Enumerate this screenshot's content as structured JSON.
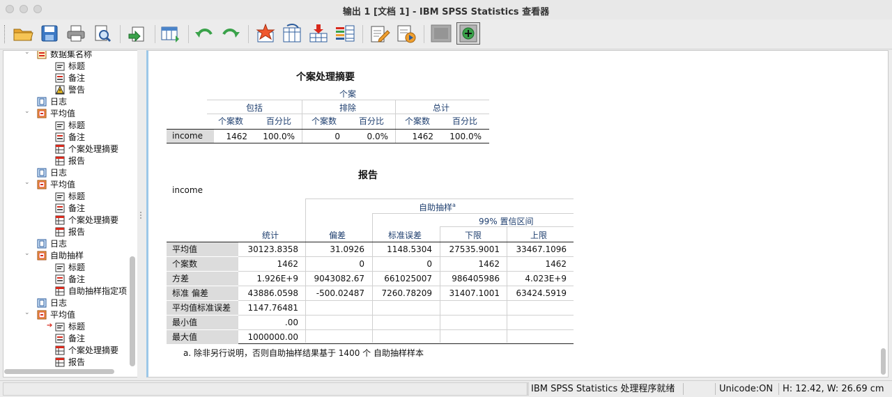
{
  "window": {
    "title": "输出 1 [文档 1] - IBM SPSS Statistics 查看器"
  },
  "toolbar": {
    "buttons": [
      {
        "icon": "open-folder-icon"
      },
      {
        "icon": "save-icon"
      },
      {
        "icon": "print-icon"
      },
      {
        "icon": "print-preview-icon"
      },
      {
        "icon": "export-icon"
      },
      {
        "icon": "goto-data-icon"
      },
      {
        "icon": "undo-icon"
      },
      {
        "icon": "redo-icon"
      },
      {
        "icon": "goto-case-icon"
      },
      {
        "icon": "goto-variable-icon"
      },
      {
        "icon": "insert-cases-icon"
      },
      {
        "icon": "variables-icon"
      },
      {
        "icon": "edit-output-icon"
      },
      {
        "icon": "run-script-icon"
      },
      {
        "icon": "hide-icon"
      },
      {
        "icon": "show-icon"
      }
    ]
  },
  "tree": {
    "items": [
      {
        "label": "数据集名称",
        "level": 2,
        "icon": "dataset-icon"
      },
      {
        "label": "标题",
        "level": 3,
        "icon": "title-icon"
      },
      {
        "label": "备注",
        "level": 3,
        "icon": "notes-icon"
      },
      {
        "label": "警告",
        "level": 3,
        "icon": "warning-icon"
      },
      {
        "label": "日志",
        "level": 2,
        "icon": "log-icon"
      },
      {
        "label": "平均值",
        "level": 1,
        "icon": "procedure-icon"
      },
      {
        "label": "标题",
        "level": 3,
        "icon": "title-icon"
      },
      {
        "label": "备注",
        "level": 3,
        "icon": "notes-icon"
      },
      {
        "label": "个案处理摘要",
        "level": 3,
        "icon": "table-icon"
      },
      {
        "label": "报告",
        "level": 3,
        "icon": "table-icon"
      },
      {
        "label": "日志",
        "level": 2,
        "icon": "log-icon"
      },
      {
        "label": "平均值",
        "level": 1,
        "icon": "procedure-icon"
      },
      {
        "label": "标题",
        "level": 3,
        "icon": "title-icon"
      },
      {
        "label": "备注",
        "level": 3,
        "icon": "notes-icon"
      },
      {
        "label": "个案处理摘要",
        "level": 3,
        "icon": "table-icon"
      },
      {
        "label": "报告",
        "level": 3,
        "icon": "table-icon"
      },
      {
        "label": "日志",
        "level": 2,
        "icon": "log-icon"
      },
      {
        "label": "自助抽样",
        "level": 1,
        "icon": "procedure-icon"
      },
      {
        "label": "标题",
        "level": 3,
        "icon": "title-icon"
      },
      {
        "label": "备注",
        "level": 3,
        "icon": "notes-icon"
      },
      {
        "label": "自助抽样指定项",
        "level": 3,
        "icon": "table-icon"
      },
      {
        "label": "日志",
        "level": 2,
        "icon": "log-icon"
      },
      {
        "label": "平均值",
        "level": 1,
        "icon": "procedure-icon"
      },
      {
        "label": "标题",
        "level": 3,
        "icon": "title-icon",
        "current": true
      },
      {
        "label": "备注",
        "level": 3,
        "icon": "notes-icon"
      },
      {
        "label": "个案处理摘要",
        "level": 3,
        "icon": "table-icon"
      },
      {
        "label": "报告",
        "level": 3,
        "icon": "table-icon"
      }
    ]
  },
  "summary": {
    "title": "个案处理摘要",
    "cases_header": "个案",
    "groups": [
      "包括",
      "排除",
      "总计"
    ],
    "subheaders": [
      "个案数",
      "百分比",
      "个案数",
      "百分比",
      "个案数",
      "百分比"
    ],
    "row_label": "income",
    "values": [
      "1462",
      "100.0%",
      "0",
      "0.0%",
      "1462",
      "100.0%"
    ]
  },
  "report": {
    "title": "报告",
    "variable": "income",
    "bootstrap_header": "自助抽样",
    "footnote_marker": "a",
    "ci_header": "99% 置信区间",
    "col_headers": [
      "统计",
      "偏差",
      "标准误差",
      "下限",
      "上限"
    ],
    "rows": [
      {
        "label": "平均值",
        "values": [
          "30123.8358",
          "31.0926",
          "1148.5304",
          "27535.9001",
          "33467.1096"
        ]
      },
      {
        "label": "个案数",
        "values": [
          "1462",
          "0",
          "0",
          "1462",
          "1462"
        ]
      },
      {
        "label": "方差",
        "values": [
          "1.926E+9",
          "9043082.67",
          "661025007",
          "986405986",
          "4.023E+9"
        ]
      },
      {
        "label": "标准 偏差",
        "values": [
          "43886.0598",
          "-500.02487",
          "7260.78209",
          "31407.1001",
          "63424.5919"
        ]
      },
      {
        "label": "平均值标准误差",
        "values": [
          "1147.76481",
          "",
          "",
          "",
          ""
        ]
      },
      {
        "label": "最小值",
        "values": [
          ".00",
          "",
          "",
          "",
          ""
        ]
      },
      {
        "label": "最大值",
        "values": [
          "1000000.00",
          "",
          "",
          "",
          ""
        ]
      }
    ],
    "footnote": "a. 除非另行说明，否则自助抽样结果基于 1400 个 自助抽样样本"
  },
  "status": {
    "message": "IBM SPSS Statistics 处理程序就绪",
    "unicode": "Unicode:ON",
    "dimensions": "H: 12.42, W: 26.69 cm"
  }
}
